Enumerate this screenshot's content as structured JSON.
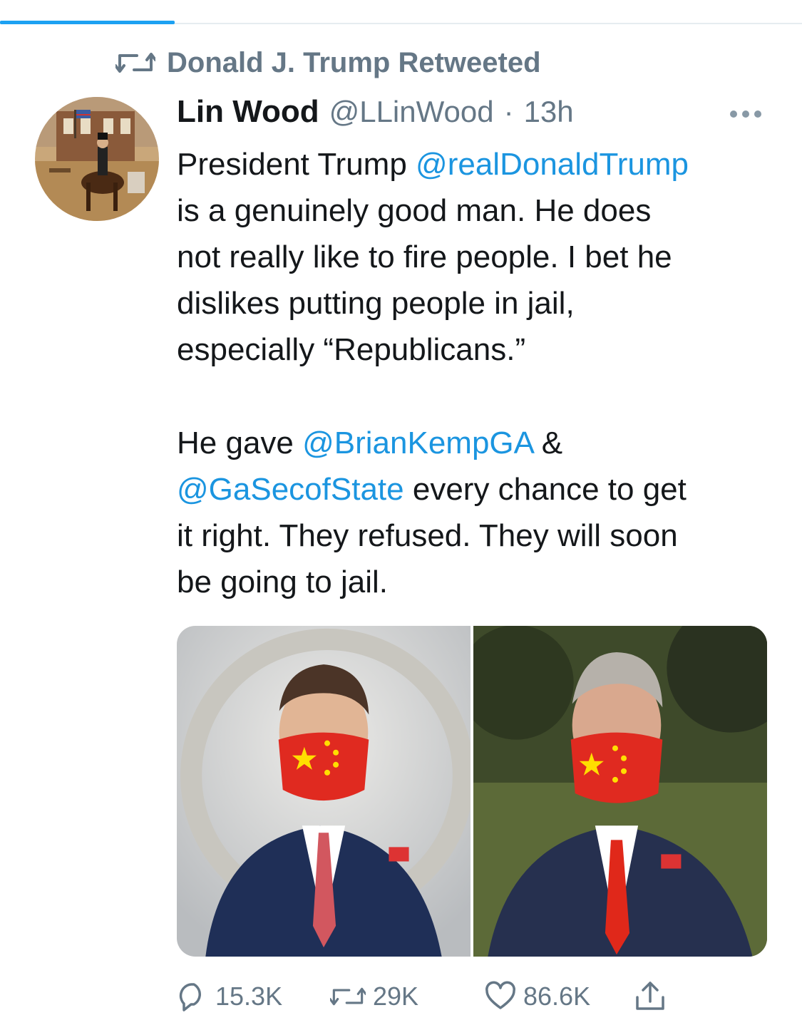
{
  "retweet_context": {
    "icon": "retweet-icon",
    "text": "Donald J. Trump Retweeted"
  },
  "author": {
    "name": "Lin Wood",
    "handle": "@LLinWood",
    "separator": "·",
    "time": "13h"
  },
  "tweet": {
    "lines": [
      [
        "President Trump ",
        "@realDonaldTrump"
      ],
      [
        "is a genuinely good man. He does"
      ],
      [
        "not really like to fire people. I bet he"
      ],
      [
        "dislikes putting people in jail,"
      ],
      [
        "especially “Republicans.”"
      ],
      [
        "He gave ",
        "@BrianKempGA",
        " &"
      ],
      [
        "@GaSecofState",
        " every chance to get"
      ],
      [
        "it right. They refused. They will soon"
      ],
      [
        "be going to jail."
      ]
    ]
  },
  "actions": {
    "reply_count": "15.3K",
    "retweet_count": "29K",
    "like_count": "86.6K"
  },
  "colors": {
    "accent": "#1da1f2",
    "mention": "#1b95e0",
    "muted": "#657786"
  }
}
